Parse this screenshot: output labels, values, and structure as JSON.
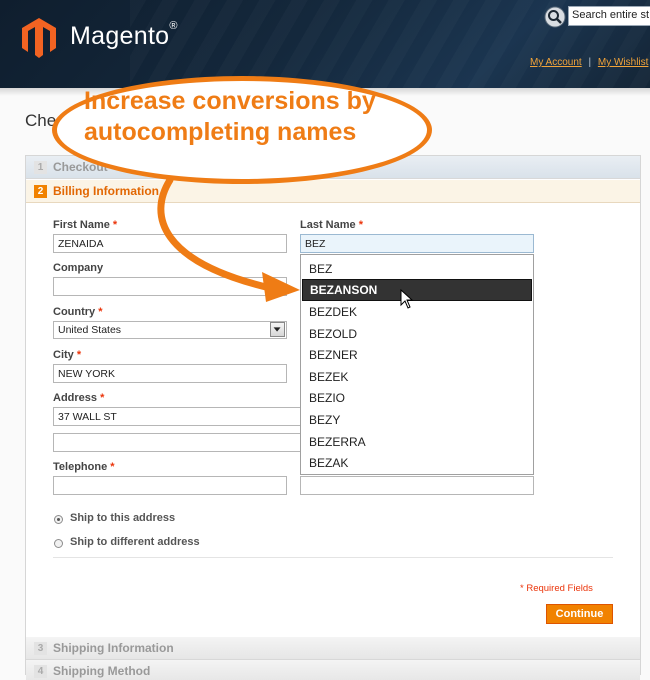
{
  "header": {
    "logo_text": "Magento",
    "logo_reg": "®",
    "search_placeholder": "Search entire st",
    "links": {
      "my_account": "My Account",
      "separator": "|",
      "my_wishlist": "My Wishlist"
    }
  },
  "page_title": "Che",
  "steps": [
    {
      "num": "1",
      "label": "Checkout"
    },
    {
      "num": "2",
      "label": "Billing Information"
    },
    {
      "num": "3",
      "label": "Shipping Information"
    },
    {
      "num": "4",
      "label": "Shipping Method"
    }
  ],
  "form": {
    "first_name": {
      "label": "First Name",
      "value": "ZENAIDA"
    },
    "last_name": {
      "label": "Last Name",
      "value": "BEZ"
    },
    "company": {
      "label": "Company",
      "value": ""
    },
    "country": {
      "label": "Country",
      "value": "United States"
    },
    "city": {
      "label": "City",
      "value": "NEW YORK"
    },
    "address": {
      "label": "Address",
      "line1": "37 WALL ST",
      "line2": ""
    },
    "telephone": {
      "label": "Telephone",
      "value": ""
    },
    "required_mark": "*",
    "ship_options": [
      {
        "label": "Ship to this address",
        "checked": true
      },
      {
        "label": "Ship to different address",
        "checked": false
      }
    ],
    "required_note": "* Required Fields",
    "continue_label": "Continue"
  },
  "autocomplete": {
    "items": [
      "BEZ",
      "BEZANSON",
      "BEZDEK",
      "BEZOLD",
      "BEZNER",
      "BEZEK",
      "BEZIO",
      "BEZY",
      "BEZERRA",
      "BEZAK"
    ],
    "selected_index": 1
  },
  "callout": {
    "line1": "Increase conversions by",
    "line2": "autocompleting names"
  },
  "colors": {
    "accent": "#f18200",
    "callout": "#ef7c15",
    "header_bg": "#14283c",
    "required": "#eb340a"
  }
}
